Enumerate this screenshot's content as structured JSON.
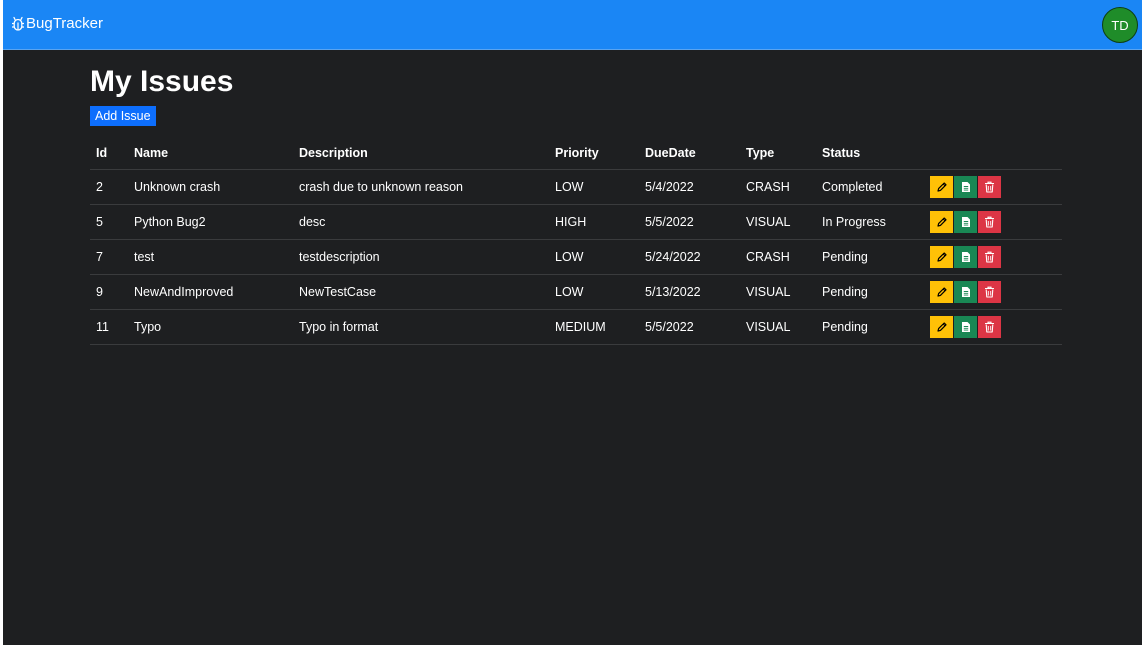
{
  "header": {
    "brand": "BugTracker",
    "avatar_initials": "TD",
    "color": "#1a86f5",
    "avatar_color": "#1f8c29"
  },
  "main": {
    "title": "My Issues",
    "add_button": "Add Issue"
  },
  "table": {
    "columns": [
      "Id",
      "Name",
      "Description",
      "Priority",
      "DueDate",
      "Type",
      "Status",
      ""
    ],
    "rows": [
      {
        "id": "2",
        "name": "Unknown crash",
        "description": "crash due to unknown reason",
        "priority": "LOW",
        "due": "5/4/2022",
        "type": "CRASH",
        "status": "Completed"
      },
      {
        "id": "5",
        "name": "Python Bug2",
        "description": "desc",
        "priority": "HIGH",
        "due": "5/5/2022",
        "type": "VISUAL",
        "status": "In Progress"
      },
      {
        "id": "7",
        "name": "test",
        "description": "testdescription",
        "priority": "LOW",
        "due": "5/24/2022",
        "type": "CRASH",
        "status": "Pending"
      },
      {
        "id": "9",
        "name": "NewAndImproved",
        "description": "NewTestCase",
        "priority": "LOW",
        "due": "5/13/2022",
        "type": "VISUAL",
        "status": "Pending"
      },
      {
        "id": "11",
        "name": "Typo",
        "description": "Typo in format",
        "priority": "MEDIUM",
        "due": "5/5/2022",
        "type": "VISUAL",
        "status": "Pending"
      }
    ],
    "row_actions": [
      {
        "key": "edit",
        "icon": "pencil-icon",
        "color": "#ffc107"
      },
      {
        "key": "view",
        "icon": "document-icon",
        "color": "#198754"
      },
      {
        "key": "delete",
        "icon": "trash-icon",
        "color": "#dc3545"
      }
    ]
  }
}
